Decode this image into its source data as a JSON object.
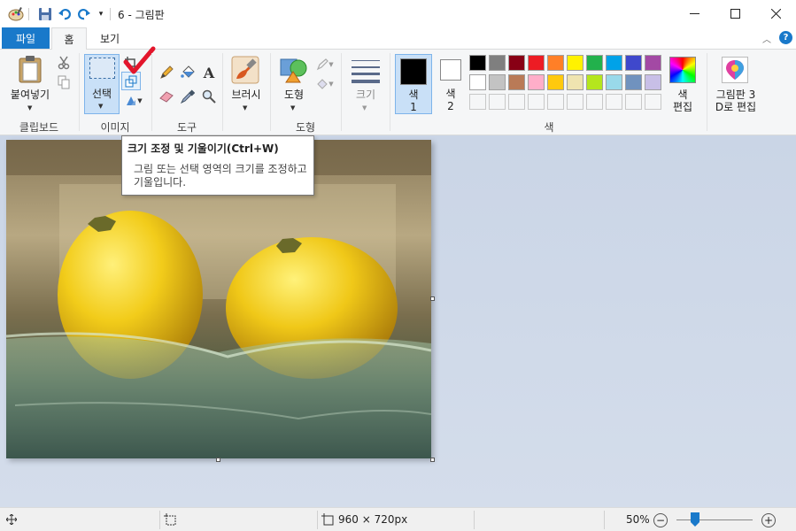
{
  "window": {
    "title": "6 - 그림판"
  },
  "tabs": {
    "file": "파일",
    "home": "홈",
    "view": "보기"
  },
  "ribbon": {
    "clipboard": {
      "paste": "붙여넣기",
      "group": "클립보드"
    },
    "image": {
      "select": "선택",
      "group": "이미지"
    },
    "tools": {
      "group": "도구"
    },
    "brushes": {
      "label": "브러시"
    },
    "shapes": {
      "label": "도형",
      "group": "도형"
    },
    "size": {
      "label": "크기"
    },
    "color1": {
      "line1": "색",
      "line2": "1"
    },
    "color2": {
      "line1": "색",
      "line2": "2"
    },
    "colors": {
      "group": "색"
    },
    "edit_colors": {
      "line1": "색",
      "line2": "편집"
    },
    "paint3d": {
      "line1": "그림판 3",
      "line2": "D로 편집"
    }
  },
  "palette": {
    "row1": [
      "#000000",
      "#7f7f7f",
      "#880015",
      "#ed1c24",
      "#ff7f27",
      "#fff200",
      "#22b14c",
      "#00a2e8",
      "#3f48cc",
      "#a349a4"
    ],
    "row2": [
      "#ffffff",
      "#c3c3c3",
      "#b97a57",
      "#ffaec9",
      "#ffc90e",
      "#efe4b0",
      "#b5e61d",
      "#99d9ea",
      "#7092be",
      "#c8bfe7"
    ]
  },
  "tooltip": {
    "title": "크기 조정 및 기울이기(Ctrl+W)",
    "desc": "그림 또는 선택 영역의 크기를 조정하고 기울입니다."
  },
  "status": {
    "dimensions": "960 × 720px",
    "zoom": "50%"
  },
  "colors": {
    "accent": "#1979ca",
    "selected_bg": "#c9e0f7"
  }
}
